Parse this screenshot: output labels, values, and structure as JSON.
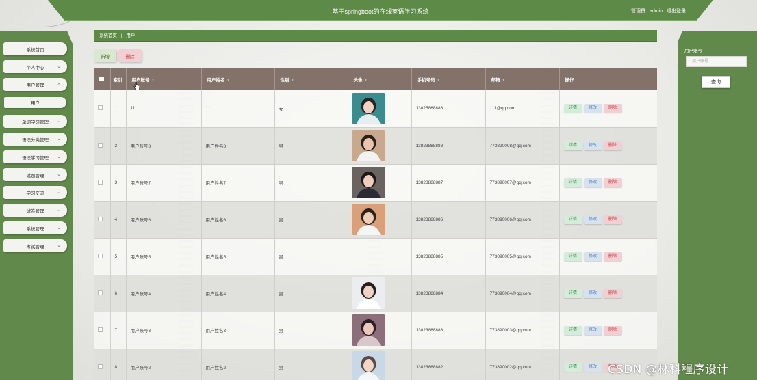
{
  "header": {
    "title": "基于springboot的在线英语学习系统",
    "user_role": "管理员",
    "user_name": "admin",
    "logout": "退出登录"
  },
  "sidebar": {
    "items": [
      {
        "label": "系统首页",
        "chevron": false
      },
      {
        "label": "个人中心",
        "chevron": true
      },
      {
        "label": "用户管理",
        "chevron": true,
        "expanded": true
      },
      {
        "label": "用户",
        "sub": true
      },
      {
        "label": "单词学习管理",
        "chevron": true
      },
      {
        "label": "语法分类管理",
        "chevron": true
      },
      {
        "label": "语法学习管理",
        "chevron": true
      },
      {
        "label": "试题管理",
        "chevron": true
      },
      {
        "label": "学习交流",
        "chevron": true
      },
      {
        "label": "试卷管理",
        "chevron": true
      },
      {
        "label": "系统管理",
        "chevron": true
      },
      {
        "label": "考试管理",
        "chevron": true
      }
    ]
  },
  "breadcrumb": {
    "home": "系统首页",
    "separator": "|",
    "current": "用户"
  },
  "actions": {
    "add": "新增",
    "delete": "删除"
  },
  "search": {
    "label": "用户账号",
    "placeholder": "用户账号",
    "button": "查询"
  },
  "table": {
    "headers": {
      "index": "索引",
      "account": "用户账号",
      "name": "用户姓名",
      "gender": "性别",
      "avatar": "头像",
      "phone": "手机号码",
      "email": "邮箱",
      "ops": "操作"
    },
    "sort_icon": "⇕",
    "ops": {
      "detail": "详情",
      "edit": "修改",
      "delete": "删除"
    },
    "rows": [
      {
        "index": "1",
        "account": "111",
        "name": "111",
        "gender": "女",
        "phone": "13825888888",
        "email": "111@qq.com",
        "avatar": "avatar-girl-1",
        "has_avatar": true
      },
      {
        "index": "2",
        "account": "用户账号8",
        "name": "用户姓名8",
        "gender": "男",
        "phone": "13823888888",
        "email": "773890008@qq.com",
        "avatar": "avatar-boy-1",
        "has_avatar": true
      },
      {
        "index": "3",
        "account": "用户账号7",
        "name": "用户姓名7",
        "gender": "男",
        "phone": "13823888887",
        "email": "773890007@qq.com",
        "avatar": "avatar-girl-2",
        "has_avatar": true
      },
      {
        "index": "4",
        "account": "用户账号6",
        "name": "用户姓名6",
        "gender": "男",
        "phone": "13823888886",
        "email": "773890006@qq.com",
        "avatar": "avatar-boy-2",
        "has_avatar": true
      },
      {
        "index": "5",
        "account": "用户账号5",
        "name": "用户姓名5",
        "gender": "男",
        "phone": "13823888885",
        "email": "773890005@qq.com",
        "avatar": "avatar-empty",
        "has_avatar": false
      },
      {
        "index": "6",
        "account": "用户账号4",
        "name": "用户姓名4",
        "gender": "男",
        "phone": "13823888884",
        "email": "773890004@qq.com",
        "avatar": "avatar-boy-3",
        "has_avatar": true
      },
      {
        "index": "7",
        "account": "用户账号3",
        "name": "用户姓名3",
        "gender": "男",
        "phone": "13823888883",
        "email": "773890003@qq.com",
        "avatar": "avatar-girl-3",
        "has_avatar": true
      },
      {
        "index": "8",
        "account": "用户账号2",
        "name": "用户姓名2",
        "gender": "男",
        "phone": "13823888882",
        "email": "773890002@qq.com",
        "avatar": "avatar-girl-4",
        "has_avatar": true
      }
    ]
  },
  "watermark": "CSDN @林科程序设计",
  "colors": {
    "green": "#5e8a48",
    "table_header": "#82726a",
    "detail": "#3a9a5e",
    "edit": "#4d7cb3",
    "danger": "#c9343f"
  }
}
